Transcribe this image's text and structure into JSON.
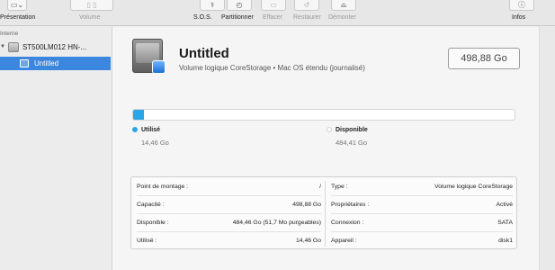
{
  "toolbar": {
    "presentation_label": "Présentation",
    "volume_label": "Volume",
    "sos_label": "S.O.S.",
    "partition_label": "Partitionner",
    "erase_label": "Effacer",
    "restore_label": "Restaurer",
    "unmount_label": "Démonter",
    "info_label": "Infos"
  },
  "sidebar": {
    "section_heading": "Interne",
    "disk_label": "ST500LM012 HN-...",
    "volume_label": "Untitled"
  },
  "volume": {
    "name": "Untitled",
    "description": "Volume logique CoreStorage • Mac OS étendu (journalisé)",
    "capacity": "498,88 Go"
  },
  "usage": {
    "used_fraction": 0.029,
    "used_label": "Utilisé",
    "used_value": "14,46 Go",
    "free_label": "Disponible",
    "free_value": "484,41 Go"
  },
  "info": {
    "left": [
      {
        "key": "Point de montage :",
        "value": "/"
      },
      {
        "key": "Capacité :",
        "value": "498,88 Go"
      },
      {
        "key": "Disponible :",
        "value": "484,46 Go (51,7 Mo purgeables)"
      },
      {
        "key": "Utilisé :",
        "value": "14,46 Go"
      }
    ],
    "right": [
      {
        "key": "Type :",
        "value": "Volume logique CoreStorage"
      },
      {
        "key": "Propriétaires :",
        "value": "Activé"
      },
      {
        "key": "Connexion :",
        "value": "SATA"
      },
      {
        "key": "Appareil :",
        "value": "disk1"
      }
    ]
  },
  "colors": {
    "accent": "#3b87e0",
    "used": "#2aa6e8",
    "free": "#ffffff"
  }
}
